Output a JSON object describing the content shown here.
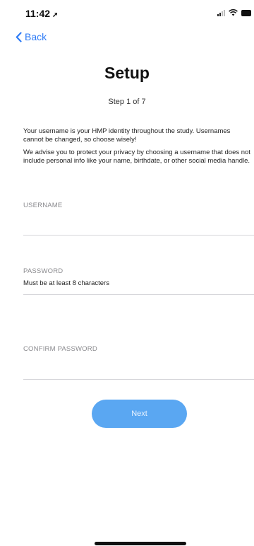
{
  "status_bar": {
    "time": "11:42",
    "location_glyph": "➚",
    "icons": [
      "signal-icon",
      "wifi-icon",
      "battery-icon"
    ]
  },
  "nav": {
    "back_label": "Back",
    "back_icon": "chevron-left-icon"
  },
  "header": {
    "title": "Setup",
    "step": "Step 1 of 7"
  },
  "intro": {
    "paragraph1": "Your username is your HMP identity throughout the study. Usernames cannot be changed, so choose wisely!",
    "paragraph2": "We advise you to protect your privacy by choosing a username that does not include personal info like your name, birthdate, or other social media handle."
  },
  "form": {
    "username": {
      "label": "USERNAME",
      "value": ""
    },
    "password": {
      "label": "PASSWORD",
      "hint": "Must be at least 8 characters",
      "value": ""
    },
    "confirm_password": {
      "label": "CONFIRM PASSWORD",
      "value": ""
    },
    "next_label": "Next"
  },
  "colors": {
    "accent": "#2f7cf6",
    "button_bg": "#5aa7f2",
    "label_gray": "#8a8a8e",
    "divider": "#d6d6da"
  }
}
